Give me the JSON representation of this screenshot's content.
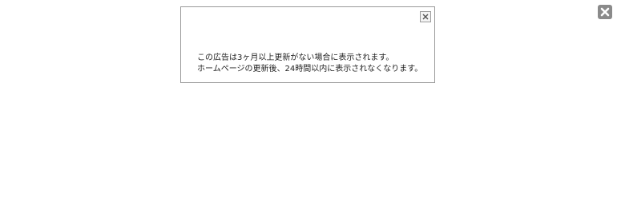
{
  "ad": {
    "line1": "この広告は3ヶ月以上更新がない場合に表示されます。",
    "line2": "ホームページの更新後、24時間以内に表示されなくなります。",
    "close_icon": "close-x-icon"
  },
  "overlay": {
    "close_icon": "close-x-icon",
    "close_color": "#8a8a8a"
  }
}
